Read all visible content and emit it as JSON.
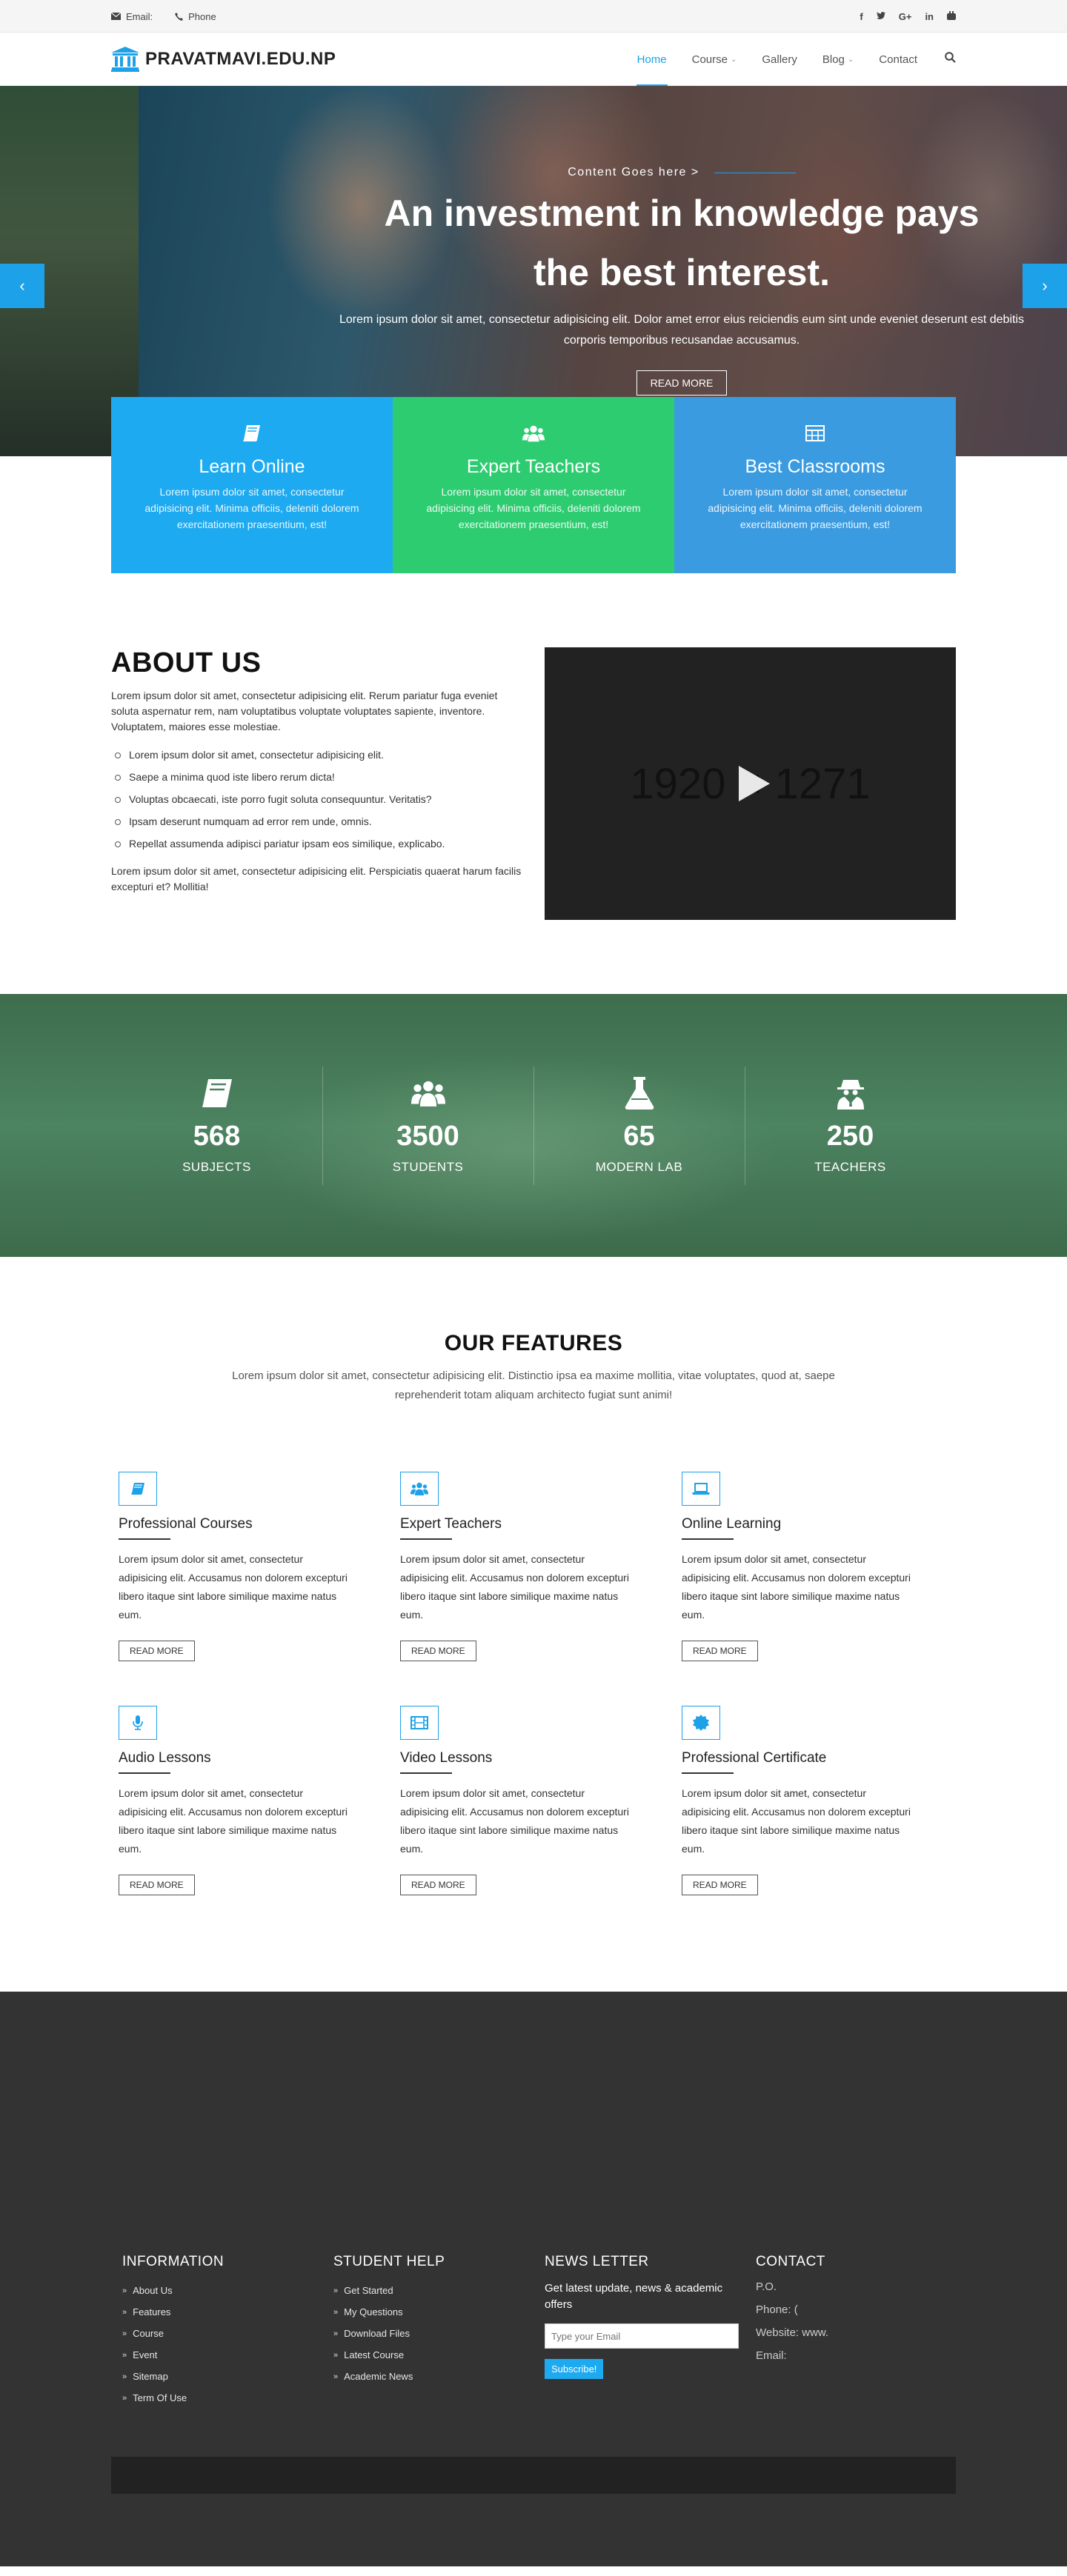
{
  "topbar": {
    "email_label": "Email:",
    "phone_label": "Phone"
  },
  "header": {
    "logo_text": "PRAVATMAVI.EDU.NP",
    "nav": [
      {
        "label": "Home",
        "active": true
      },
      {
        "label": "Course",
        "dropdown": true
      },
      {
        "label": "Gallery"
      },
      {
        "label": "Blog",
        "dropdown": true
      },
      {
        "label": "Contact"
      }
    ]
  },
  "hero": {
    "kicker": "Content Goes here >",
    "title_line1": "An investment in knowledge pays",
    "title_line2": "the best interest.",
    "text": "Lorem ipsum dolor sit amet, consectetur adipisicing elit. Dolor amet error eius reiciendis eum sint unde eveniet deserunt est debitis corporis temporibus recusandae accusamus.",
    "button": "READ MORE"
  },
  "boxes": [
    {
      "title": "Learn Online",
      "text": "Lorem ipsum dolor sit amet, consectetur adipisicing elit. Minima officiis, deleniti dolorem exercitationem praesentium, est!",
      "color": "#1daaf0"
    },
    {
      "title": "Expert Teachers",
      "text": "Lorem ipsum dolor sit amet, consectetur adipisicing elit. Minima officiis, deleniti dolorem exercitationem praesentium, est!",
      "color": "#2ecc71"
    },
    {
      "title": "Best Classrooms",
      "text": "Lorem ipsum dolor sit amet, consectetur adipisicing elit. Minima officiis, deleniti dolorem exercitationem praesentium, est!",
      "color": "#3b9be0"
    }
  ],
  "about": {
    "title": "ABOUT US",
    "intro": "Lorem ipsum dolor sit amet, consectetur adipisicing elit. Rerum pariatur fuga eveniet soluta aspernatur rem, nam voluptatibus voluptate voluptates sapiente, inventore. Voluptatem, maiores esse molestiae.",
    "list": [
      "Lorem ipsum dolor sit amet, consectetur adipisicing elit.",
      "Saepe a minima quod iste libero rerum dicta!",
      "Voluptas obcaecati, iste porro fugit soluta consequuntur. Veritatis?",
      "Ipsam deserunt numquam ad error rem unde, omnis.",
      "Repellat assumenda adipisci pariatur ipsam eos similique, explicabo."
    ],
    "outro": "Lorem ipsum dolor sit amet, consectetur adipisicing elit. Perspiciatis quaerat harum facilis excepturi et? Mollitia!",
    "video_placeholder": "1920 × 1271"
  },
  "counters": [
    {
      "number": "568",
      "label": "SUBJECTS"
    },
    {
      "number": "3500",
      "label": "STUDENTS"
    },
    {
      "number": "65",
      "label": "MODERN LAB"
    },
    {
      "number": "250",
      "label": "TEACHERS"
    }
  ],
  "features": {
    "title": "OUR FEATURES",
    "subtitle": "Lorem ipsum dolor sit amet, consectetur adipisicing elit. Distinctio ipsa ea maxime mollitia, vitae voluptates, quod at, saepe reprehenderit totam aliquam architecto fugiat sunt animi!",
    "items": [
      {
        "title": "Professional Courses",
        "text": "Lorem ipsum dolor sit amet, consectetur adipisicing elit. Accusamus non dolorem excepturi libero itaque sint labore similique maxime natus eum.",
        "button": "READ MORE"
      },
      {
        "title": "Expert Teachers",
        "text": "Lorem ipsum dolor sit amet, consectetur adipisicing elit. Accusamus non dolorem excepturi libero itaque sint labore similique maxime natus eum.",
        "button": "READ MORE"
      },
      {
        "title": "Online Learning",
        "text": "Lorem ipsum dolor sit amet, consectetur adipisicing elit. Accusamus non dolorem excepturi libero itaque sint labore similique maxime natus eum.",
        "button": "READ MORE"
      },
      {
        "title": "Audio Lessons",
        "text": "Lorem ipsum dolor sit amet, consectetur adipisicing elit. Accusamus non dolorem excepturi libero itaque sint labore similique maxime natus eum.",
        "button": "READ MORE"
      },
      {
        "title": "Video Lessons",
        "text": "Lorem ipsum dolor sit amet, consectetur adipisicing elit. Accusamus non dolorem excepturi libero itaque sint labore similique maxime natus eum.",
        "button": "READ MORE"
      },
      {
        "title": "Professional Certificate",
        "text": "Lorem ipsum dolor sit amet, consectetur adipisicing elit. Accusamus non dolorem excepturi libero itaque sint labore similique maxime natus eum.",
        "button": "READ MORE"
      }
    ]
  },
  "footer": {
    "information": {
      "title": "INFORMATION",
      "links": [
        "About Us",
        "Features",
        "Course",
        "Event",
        "Sitemap",
        "Term Of Use"
      ]
    },
    "student_help": {
      "title": "STUDENT HELP",
      "links": [
        "Get Started",
        "My Questions",
        "Download Files",
        "Latest Course",
        "Academic News"
      ]
    },
    "newsletter": {
      "title": "NEWS LETTER",
      "text": "Get latest update, news & academic offers",
      "placeholder": "Type your Email",
      "button": "Subscribe!"
    },
    "contact": {
      "title": "CONTACT",
      "po": "P.O.",
      "phone": "Phone: (",
      "website": "Website: www.",
      "email": "Email:"
    }
  }
}
